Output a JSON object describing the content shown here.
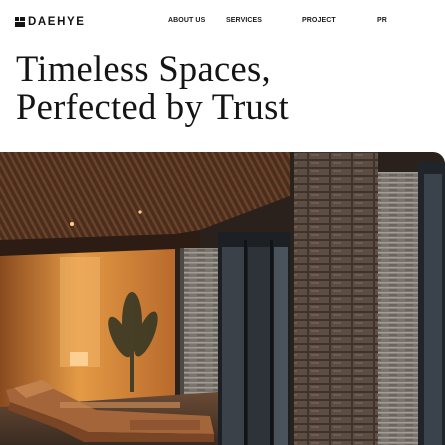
{
  "brand": {
    "name": "DAEHYE",
    "logo_icon": "brick-mark-icon"
  },
  "nav": {
    "items": [
      {
        "label": "ABOUT US"
      },
      {
        "label": "SERVICES"
      },
      {
        "label": "PROJECT"
      },
      {
        "label": "PR"
      }
    ]
  },
  "hero": {
    "title_line1": "Timeless Spaces,",
    "title_line2": "Perfected by Trust",
    "image": {
      "subject": "interior-lounge-photo",
      "colors": {
        "ceiling_wood": "#5a3a26",
        "stone_wall": "#6f6863",
        "warm_glow": "#e0913f",
        "window_dark": "#1c1f24"
      }
    }
  }
}
